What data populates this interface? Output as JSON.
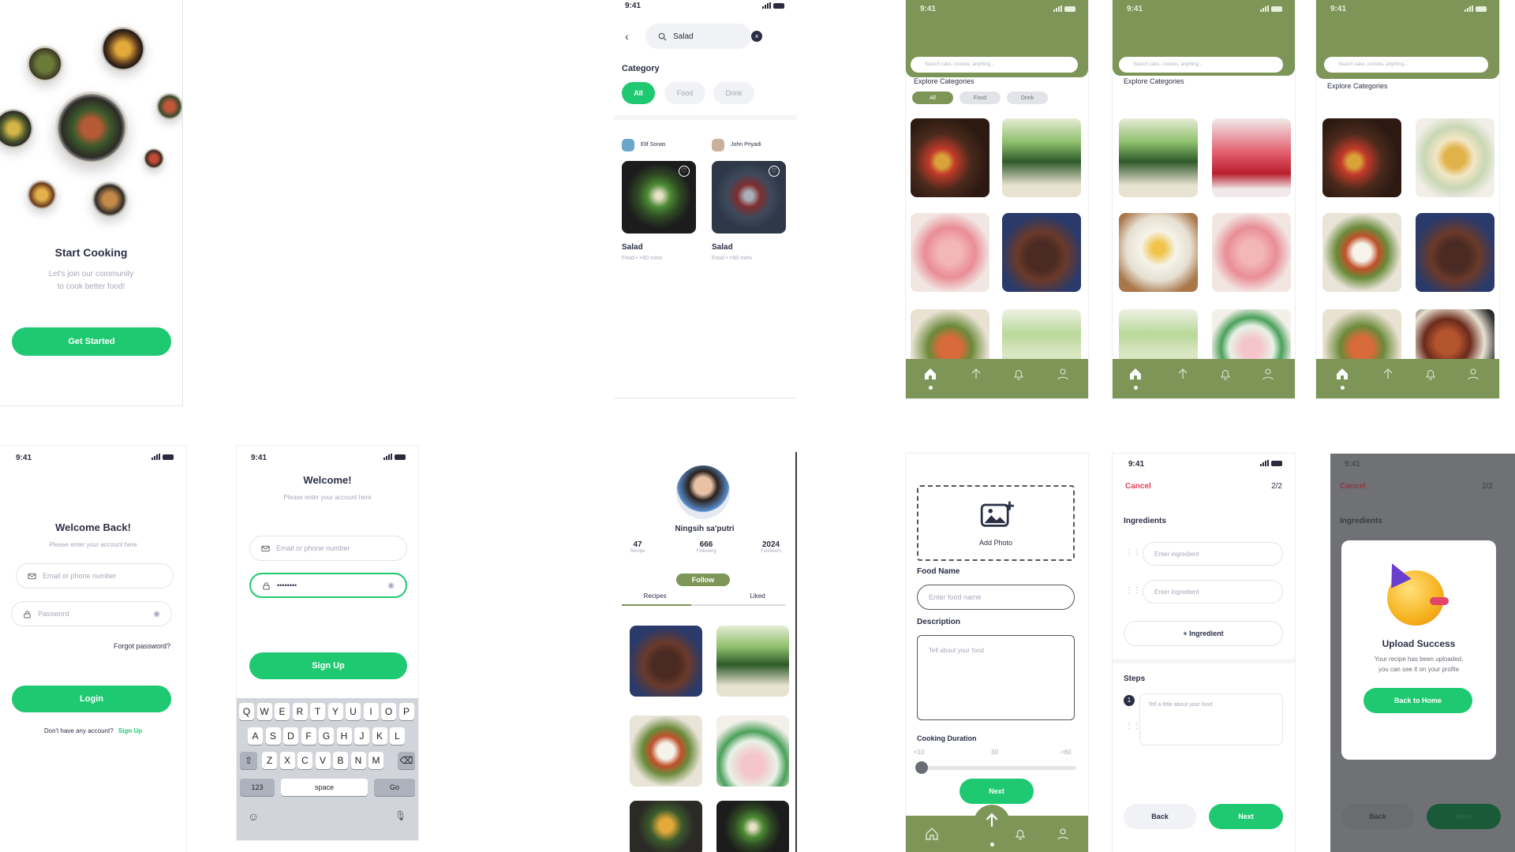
{
  "status_time": "9:41",
  "start": {
    "title": "Start Cooking",
    "subtitle_1": "Let's join our community",
    "subtitle_2": "to cook better food!",
    "button": "Get Started"
  },
  "search": {
    "query": "Salad",
    "category_label": "Category",
    "chips": [
      "All",
      "Food",
      "Drink"
    ],
    "cards": [
      {
        "author": "Elif Sonas",
        "title": "Salad",
        "meta": "Food • >60 mins"
      },
      {
        "author": "John Priyadi",
        "title": "Salad",
        "meta": "Food • >60 mins"
      }
    ]
  },
  "explore": {
    "search_placeholder": "Search cake, cookies, anything...",
    "categories_label": "Explore Categories",
    "chips": [
      "All",
      "Food",
      "Drink"
    ]
  },
  "login": {
    "title": "Welcome Back!",
    "subtitle": "Please enter your account here",
    "email_placeholder": "Email or phone number",
    "password_placeholder": "Password",
    "forgot": "Forgot password?",
    "button": "Login",
    "footer_text": "Don't have any account?",
    "footer_link": "Sign Up"
  },
  "signup": {
    "title": "Welcome!",
    "subtitle": "Please enter your account here",
    "email_placeholder": "Email or phone number",
    "password_value": "••••••••",
    "button": "Sign Up",
    "keyboard_rows": [
      [
        "Q",
        "W",
        "E",
        "R",
        "T",
        "Y",
        "U",
        "I",
        "O",
        "P"
      ],
      [
        "A",
        "S",
        "D",
        "F",
        "G",
        "H",
        "J",
        "K",
        "L"
      ],
      [
        "Z",
        "X",
        "C",
        "V",
        "B",
        "N",
        "M"
      ]
    ],
    "key_123": "123",
    "key_space": "space",
    "key_go": "Go"
  },
  "profile": {
    "name": "Ningsih sa'putri",
    "stats": [
      {
        "value": "47",
        "label": "Recipe"
      },
      {
        "value": "666",
        "label": "Following"
      },
      {
        "value": "2024",
        "label": "Followers"
      }
    ],
    "follow": "Follow",
    "tabs": [
      "Recipes",
      "Liked"
    ]
  },
  "upload1": {
    "add_photo": "Add Photo",
    "food_name_label": "Food Name",
    "food_name_placeholder": "Enter food name",
    "description_label": "Description",
    "description_placeholder": "Tell about your food",
    "duration_label": "Cooking Duration",
    "duration_marks": [
      "<10",
      "30",
      ">60"
    ],
    "next": "Next"
  },
  "upload2": {
    "cancel": "Cancel",
    "step": "2/2",
    "ingredients_label": "Ingredients",
    "ingredient_placeholder": "Enter ingredient",
    "add_ingredient": "+ Ingredient",
    "steps_label": "Steps",
    "step_number": "1",
    "step_placeholder": "Tell a little about your food",
    "back": "Back",
    "next": "Next"
  },
  "success": {
    "title": "Upload Success",
    "text_1": "Your recipe has been uploaded,",
    "text_2": "you can see it on your profile",
    "button": "Back to Home"
  },
  "colors": {
    "green": "#1fc971",
    "olive": "#7d9557",
    "text": "#2b2f45",
    "muted": "#a5a9b8"
  }
}
